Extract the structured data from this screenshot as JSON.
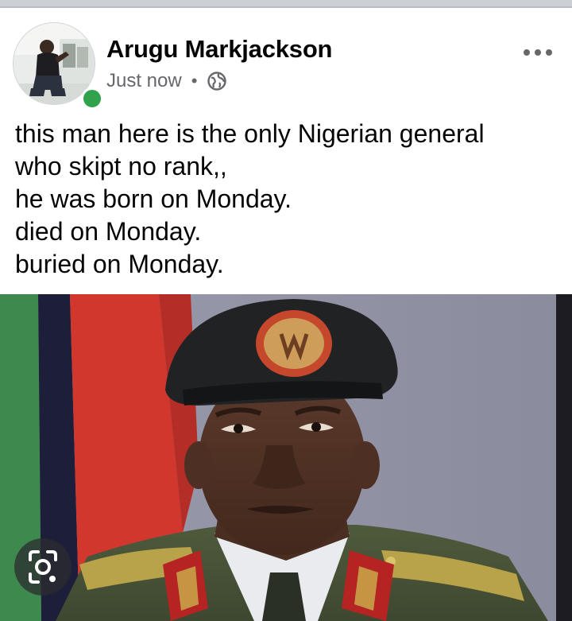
{
  "post": {
    "author": "Arugu Markjackson",
    "timestamp": "Just now",
    "separator": "•",
    "visibility_icon": "globe-icon",
    "menu_icon": "more-horizontal-icon",
    "author_online": true,
    "text_lines": [
      "this man here is the only Nigerian general",
      "who skipt no rank,,",
      "he was born on Monday.",
      "died on Monday.",
      "buried on Monday."
    ]
  },
  "photo": {
    "subject": "military portrait",
    "overlay_icon": "lens-search-icon"
  },
  "colors": {
    "online": "#31a24c",
    "secondary_text": "#65676b",
    "primary_text": "#050505",
    "divider": "#ccd0d5"
  }
}
